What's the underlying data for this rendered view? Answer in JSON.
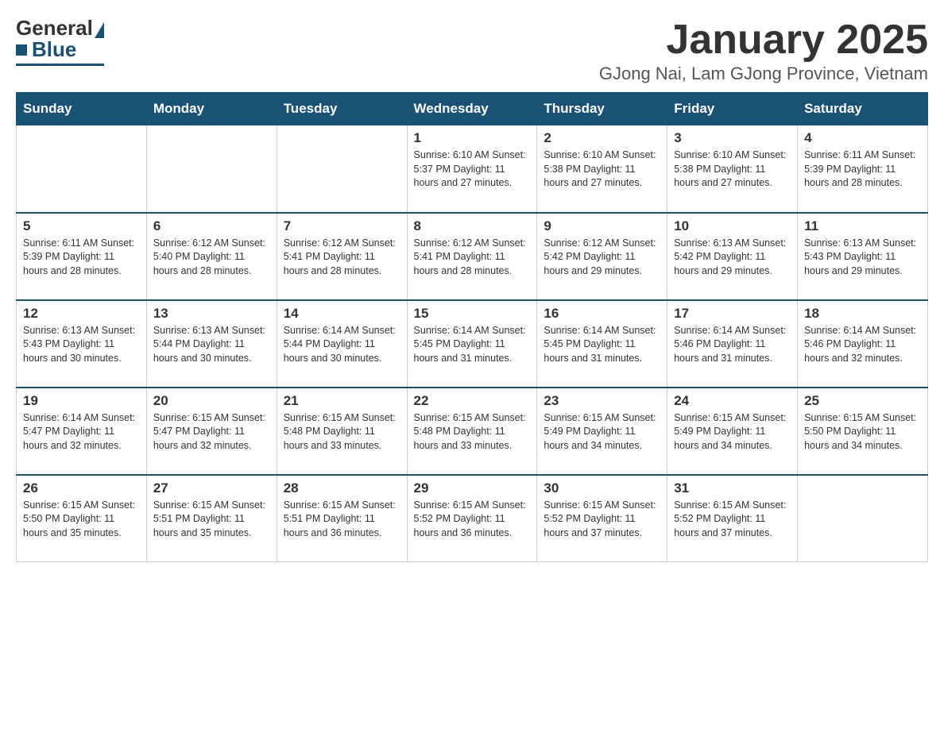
{
  "logo": {
    "general": "General",
    "blue": "Blue"
  },
  "title": "January 2025",
  "subtitle": "GJong Nai, Lam GJong Province, Vietnam",
  "days": [
    "Sunday",
    "Monday",
    "Tuesday",
    "Wednesday",
    "Thursday",
    "Friday",
    "Saturday"
  ],
  "weeks": [
    [
      {
        "num": "",
        "info": ""
      },
      {
        "num": "",
        "info": ""
      },
      {
        "num": "",
        "info": ""
      },
      {
        "num": "1",
        "info": "Sunrise: 6:10 AM\nSunset: 5:37 PM\nDaylight: 11 hours and 27 minutes."
      },
      {
        "num": "2",
        "info": "Sunrise: 6:10 AM\nSunset: 5:38 PM\nDaylight: 11 hours and 27 minutes."
      },
      {
        "num": "3",
        "info": "Sunrise: 6:10 AM\nSunset: 5:38 PM\nDaylight: 11 hours and 27 minutes."
      },
      {
        "num": "4",
        "info": "Sunrise: 6:11 AM\nSunset: 5:39 PM\nDaylight: 11 hours and 28 minutes."
      }
    ],
    [
      {
        "num": "5",
        "info": "Sunrise: 6:11 AM\nSunset: 5:39 PM\nDaylight: 11 hours and 28 minutes."
      },
      {
        "num": "6",
        "info": "Sunrise: 6:12 AM\nSunset: 5:40 PM\nDaylight: 11 hours and 28 minutes."
      },
      {
        "num": "7",
        "info": "Sunrise: 6:12 AM\nSunset: 5:41 PM\nDaylight: 11 hours and 28 minutes."
      },
      {
        "num": "8",
        "info": "Sunrise: 6:12 AM\nSunset: 5:41 PM\nDaylight: 11 hours and 28 minutes."
      },
      {
        "num": "9",
        "info": "Sunrise: 6:12 AM\nSunset: 5:42 PM\nDaylight: 11 hours and 29 minutes."
      },
      {
        "num": "10",
        "info": "Sunrise: 6:13 AM\nSunset: 5:42 PM\nDaylight: 11 hours and 29 minutes."
      },
      {
        "num": "11",
        "info": "Sunrise: 6:13 AM\nSunset: 5:43 PM\nDaylight: 11 hours and 29 minutes."
      }
    ],
    [
      {
        "num": "12",
        "info": "Sunrise: 6:13 AM\nSunset: 5:43 PM\nDaylight: 11 hours and 30 minutes."
      },
      {
        "num": "13",
        "info": "Sunrise: 6:13 AM\nSunset: 5:44 PM\nDaylight: 11 hours and 30 minutes."
      },
      {
        "num": "14",
        "info": "Sunrise: 6:14 AM\nSunset: 5:44 PM\nDaylight: 11 hours and 30 minutes."
      },
      {
        "num": "15",
        "info": "Sunrise: 6:14 AM\nSunset: 5:45 PM\nDaylight: 11 hours and 31 minutes."
      },
      {
        "num": "16",
        "info": "Sunrise: 6:14 AM\nSunset: 5:45 PM\nDaylight: 11 hours and 31 minutes."
      },
      {
        "num": "17",
        "info": "Sunrise: 6:14 AM\nSunset: 5:46 PM\nDaylight: 11 hours and 31 minutes."
      },
      {
        "num": "18",
        "info": "Sunrise: 6:14 AM\nSunset: 5:46 PM\nDaylight: 11 hours and 32 minutes."
      }
    ],
    [
      {
        "num": "19",
        "info": "Sunrise: 6:14 AM\nSunset: 5:47 PM\nDaylight: 11 hours and 32 minutes."
      },
      {
        "num": "20",
        "info": "Sunrise: 6:15 AM\nSunset: 5:47 PM\nDaylight: 11 hours and 32 minutes."
      },
      {
        "num": "21",
        "info": "Sunrise: 6:15 AM\nSunset: 5:48 PM\nDaylight: 11 hours and 33 minutes."
      },
      {
        "num": "22",
        "info": "Sunrise: 6:15 AM\nSunset: 5:48 PM\nDaylight: 11 hours and 33 minutes."
      },
      {
        "num": "23",
        "info": "Sunrise: 6:15 AM\nSunset: 5:49 PM\nDaylight: 11 hours and 34 minutes."
      },
      {
        "num": "24",
        "info": "Sunrise: 6:15 AM\nSunset: 5:49 PM\nDaylight: 11 hours and 34 minutes."
      },
      {
        "num": "25",
        "info": "Sunrise: 6:15 AM\nSunset: 5:50 PM\nDaylight: 11 hours and 34 minutes."
      }
    ],
    [
      {
        "num": "26",
        "info": "Sunrise: 6:15 AM\nSunset: 5:50 PM\nDaylight: 11 hours and 35 minutes."
      },
      {
        "num": "27",
        "info": "Sunrise: 6:15 AM\nSunset: 5:51 PM\nDaylight: 11 hours and 35 minutes."
      },
      {
        "num": "28",
        "info": "Sunrise: 6:15 AM\nSunset: 5:51 PM\nDaylight: 11 hours and 36 minutes."
      },
      {
        "num": "29",
        "info": "Sunrise: 6:15 AM\nSunset: 5:52 PM\nDaylight: 11 hours and 36 minutes."
      },
      {
        "num": "30",
        "info": "Sunrise: 6:15 AM\nSunset: 5:52 PM\nDaylight: 11 hours and 37 minutes."
      },
      {
        "num": "31",
        "info": "Sunrise: 6:15 AM\nSunset: 5:52 PM\nDaylight: 11 hours and 37 minutes."
      },
      {
        "num": "",
        "info": ""
      }
    ]
  ]
}
